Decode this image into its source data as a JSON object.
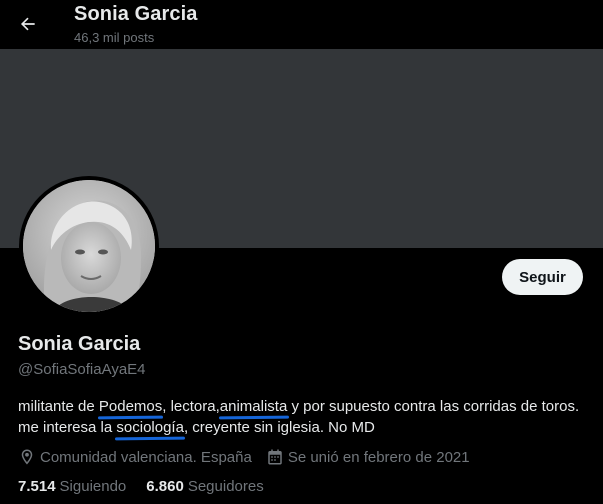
{
  "header": {
    "title": "Sonia Garcia",
    "posts_count": "46,3 mil posts",
    "back_icon": "arrow-left-icon"
  },
  "profile": {
    "name": "Sonia Garcia",
    "handle": "@SofiaSofiaAyaE4",
    "follow_label": "Seguir",
    "bio": {
      "p1": "militante de ",
      "h1": "Podemos",
      "p2": ", lectora,",
      "h2": "animalista",
      "p3": " y por supuesto contra las corridas de toros. me interesa la ",
      "h3": "sociología",
      "p4": ", creyente sin iglesia. No MD"
    },
    "location": "Comunidad valenciana. España",
    "joined": "Se unió en febrero de 2021",
    "following_count": "7.514",
    "following_label": "Siguiendo",
    "followers_count": "6.860",
    "followers_label": "Seguidores"
  },
  "colors": {
    "background": "#000000",
    "banner": "#333639",
    "secondary_text": "#71767b",
    "primary_text": "#e7e9ea",
    "annotation_underline": "#1565d8",
    "button_bg": "#eff3f4"
  }
}
